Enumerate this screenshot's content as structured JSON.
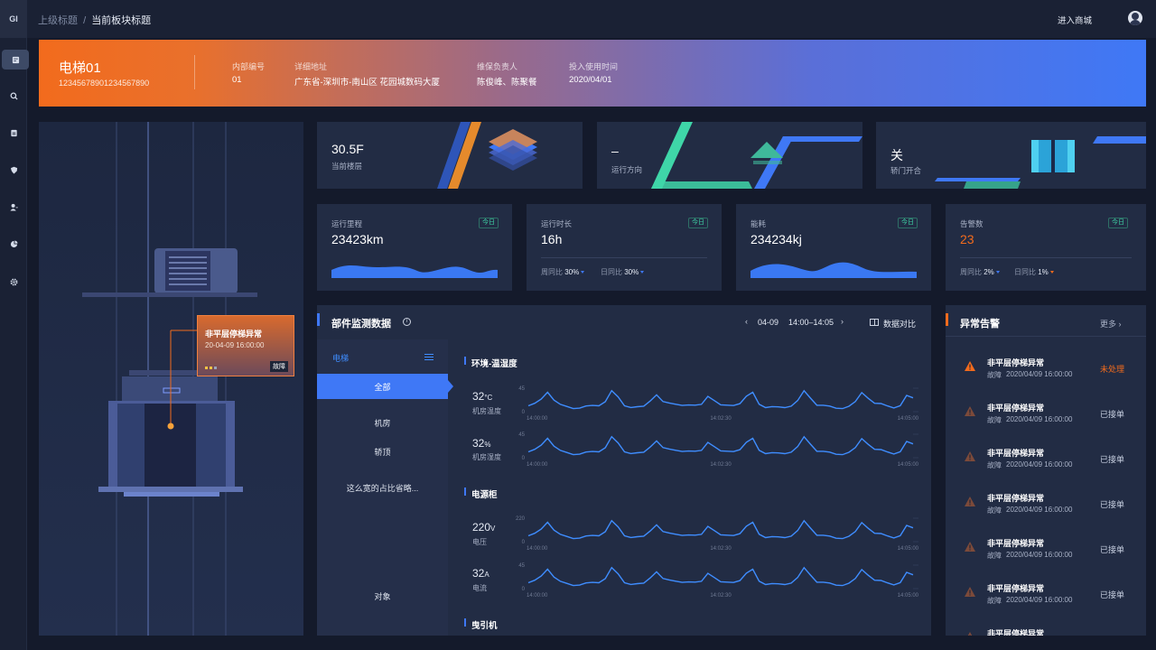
{
  "logo": "GI",
  "topbar": {
    "breadcrumb_parent": "上级标题",
    "breadcrumb_sep": "/",
    "breadcrumb_current": "当前板块标题",
    "mall_link": "进入商城"
  },
  "sidebar": {
    "icons": [
      "list-icon",
      "search-icon",
      "clipboard-icon",
      "shield-icon",
      "user-icon",
      "pie-chart-icon",
      "gear-icon"
    ]
  },
  "banner": {
    "name": "电梯01",
    "code": "12345678901234567890",
    "fields": [
      {
        "label": "内部编号",
        "value": "01"
      },
      {
        "label": "详细地址",
        "value": "广东省-深圳市-南山区 花园城数码大厦"
      },
      {
        "label": "维保负责人",
        "value": "陈俊峰、陈聚餐"
      },
      {
        "label": "投入使用时间",
        "value": "2020/04/01"
      }
    ]
  },
  "shaft_popup": {
    "title": "非平层停梯异常",
    "time": "20-04-09 16:00:00",
    "badge": "故障"
  },
  "status": {
    "floor": {
      "value": "30.5F",
      "label": "当前楼层"
    },
    "direction": {
      "value": "–",
      "label": "运行方向"
    },
    "door": {
      "value": "关",
      "label": "轿门开合"
    }
  },
  "metrics": [
    {
      "label": "运行里程",
      "value": "23423km",
      "tag": "今日"
    },
    {
      "label": "运行时长",
      "value": "16h",
      "tag": "今日",
      "wow_label": "周同比",
      "wow": "30%",
      "dod_label": "日同比",
      "dod": "30%"
    },
    {
      "label": "能耗",
      "value": "234234kj",
      "tag": "今日"
    },
    {
      "label": "告警数",
      "value": "23",
      "tag": "今日",
      "wow_label": "周同比",
      "wow": "2%",
      "dod_label": "日同比",
      "dod": "1%"
    }
  ],
  "monitor": {
    "title": "部件监测数据",
    "date": "04-09",
    "range": "14:00–14:05",
    "compare": "数据对比",
    "nav_header": "电梯",
    "nav_items": [
      "全部",
      "机房",
      "轿顶",
      "这么宽的占比省略...",
      "对象"
    ],
    "sections": [
      "环境-温湿度",
      "电源柜",
      "曳引机"
    ],
    "rows": [
      {
        "value": "32",
        "unit": "°C",
        "label": "机房温度",
        "ymax": "45",
        "ymin": "0"
      },
      {
        "value": "32",
        "unit": "%",
        "label": "机房湿度",
        "ymax": "45",
        "ymin": "0"
      },
      {
        "value": "220",
        "unit": "V",
        "label": "电压",
        "ymax": "220",
        "ymin": "0"
      },
      {
        "value": "32",
        "unit": "A",
        "label": "电流",
        "ymax": "45",
        "ymin": "0"
      }
    ],
    "x_ticks": [
      "14:00:00",
      "14:02:30",
      "14:05:00"
    ]
  },
  "alarms": {
    "title": "异常告警",
    "more": "更多",
    "items": [
      {
        "title": "非平层停梯异常",
        "type": "故障",
        "time": "2020/04/09 16:00:00",
        "status": "未处理"
      },
      {
        "title": "非平层停梯异常",
        "type": "故障",
        "time": "2020/04/09 16:00:00",
        "status": "已接单"
      },
      {
        "title": "非平层停梯异常",
        "type": "故障",
        "time": "2020/04/09 16:00:00",
        "status": "已接单"
      },
      {
        "title": "非平层停梯异常",
        "type": "故障",
        "time": "2020/04/09 16:00:00",
        "status": "已接单"
      },
      {
        "title": "非平层停梯异常",
        "type": "故障",
        "time": "2020/04/09 16:00:00",
        "status": "已接单"
      },
      {
        "title": "非平层停梯异常",
        "type": "故障",
        "time": "2020/04/09 16:00:00",
        "status": "已接单"
      },
      {
        "title": "非平层停梯异常",
        "type": "",
        "time": "",
        "status": ""
      }
    ]
  },
  "colors": {
    "accent": "#3f78f6",
    "warning": "#f26b1d",
    "teal": "#3fd6a8"
  }
}
